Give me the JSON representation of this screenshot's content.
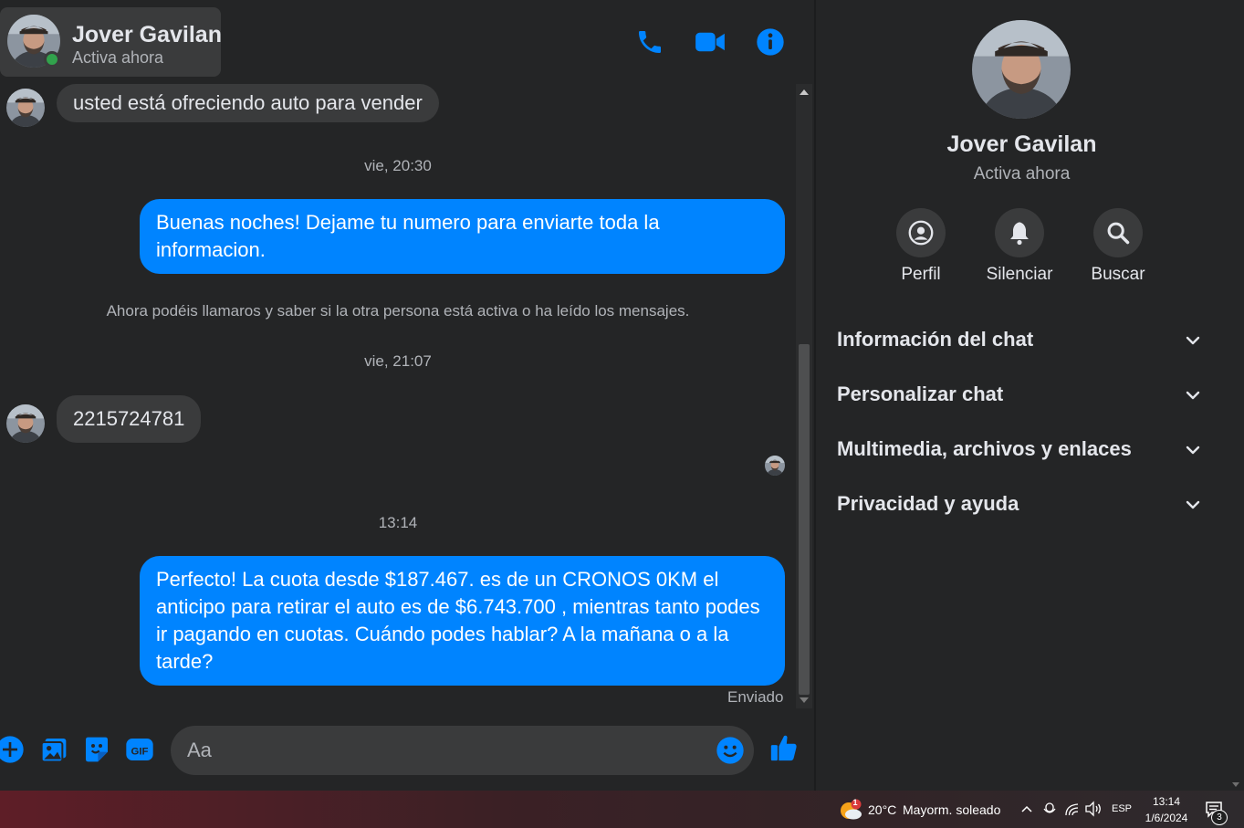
{
  "header": {
    "name": "Jover Gavilan",
    "status": "Activa ahora"
  },
  "messages": {
    "m1": "usted está ofreciendo auto para vender",
    "ts1": "vie, 20:30",
    "m2": "Buenas noches! Dejame tu numero para enviarte toda la informacion.",
    "notice": "Ahora podéis llamaros y saber si la otra persona está activa o ha leído los mensajes.",
    "ts2": "vie, 21:07",
    "m3": "2215724781",
    "ts3": "13:14",
    "m4": "Perfecto! La cuota desde $187.467. es de un CRONOS 0KM el anticipo para retirar el auto es de $6.743.700 , mientras tanto podes ir pagando en cuotas. Cuándo podes hablar? A la mañana o a la tarde?",
    "sent": "Enviado"
  },
  "composer": {
    "placeholder": "Aa"
  },
  "info": {
    "name": "Jover Gavilan",
    "status": "Activa ahora",
    "actions": [
      {
        "label": "Perfil",
        "icon": "profile-icon"
      },
      {
        "label": "Silenciar",
        "icon": "bell-icon"
      },
      {
        "label": "Buscar",
        "icon": "search-icon"
      }
    ],
    "sections": [
      "Información del chat",
      "Personalizar chat",
      "Multimedia, archivos y enlaces",
      "Privacidad y ayuda"
    ]
  },
  "taskbar": {
    "weather_temp": "20°C",
    "weather_text": "Mayorm. soleado",
    "weather_badge": "1",
    "lang": "ESP",
    "time": "13:14",
    "date": "1/6/2024",
    "notif_count": "3"
  },
  "colors": {
    "accent": "#0084ff",
    "online": "#31a24c",
    "bubble_in": "#3a3b3c",
    "bg": "#242526"
  }
}
